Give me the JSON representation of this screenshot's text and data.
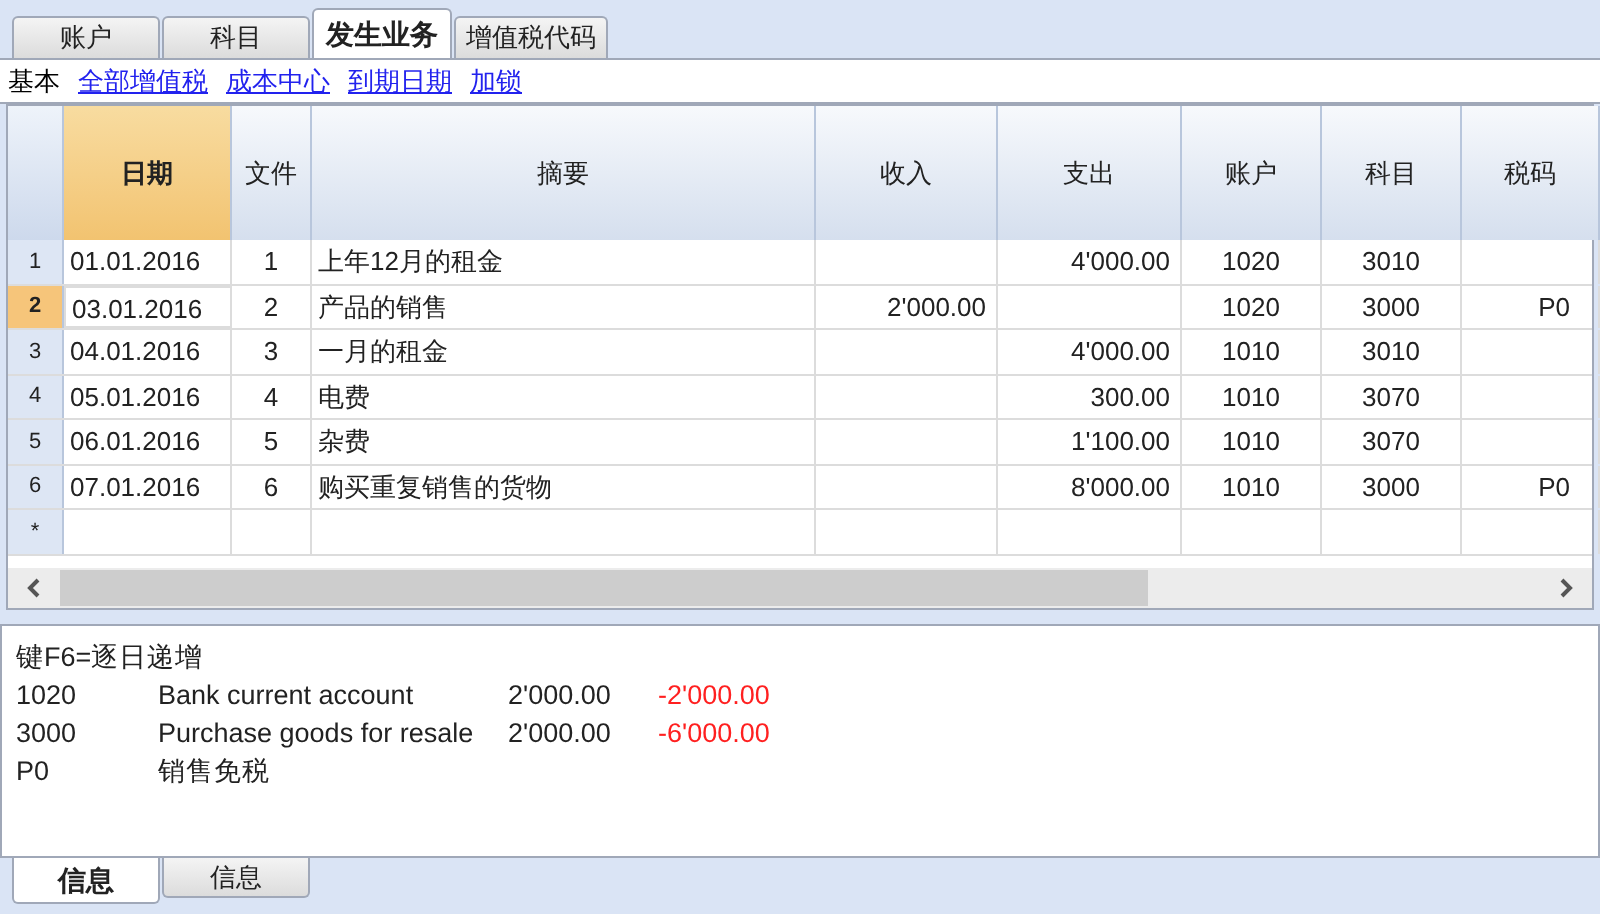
{
  "tabs": [
    {
      "label": "账户",
      "selected": false
    },
    {
      "label": "科目",
      "selected": false
    },
    {
      "label": "发生业务",
      "selected": true
    },
    {
      "label": "增值税代码",
      "selected": false
    }
  ],
  "views": [
    {
      "label": "基本",
      "selected": true
    },
    {
      "label": "全部增值税",
      "selected": false
    },
    {
      "label": "成本中心",
      "selected": false
    },
    {
      "label": "到期日期",
      "selected": false
    },
    {
      "label": "加锁",
      "selected": false
    }
  ],
  "table": {
    "columns": [
      {
        "label": "日期",
        "selected": true
      },
      {
        "label": "文件",
        "selected": false
      },
      {
        "label": "摘要",
        "selected": false
      },
      {
        "label": "收入",
        "selected": false
      },
      {
        "label": "支出",
        "selected": false
      },
      {
        "label": "账户",
        "selected": false
      },
      {
        "label": "科目",
        "selected": false
      },
      {
        "label": "税码",
        "selected": false
      }
    ],
    "rows": [
      {
        "row_header": "1",
        "selected": false,
        "cells": [
          "01.01.2016",
          "1",
          "上年12月的租金",
          "",
          "4'000.00",
          "1020",
          "3010",
          ""
        ]
      },
      {
        "row_header": "2",
        "selected": true,
        "cells": [
          "03.01.2016",
          "2",
          "产品的销售",
          "2'000.00",
          "",
          "1020",
          "3000",
          "P0"
        ]
      },
      {
        "row_header": "3",
        "selected": false,
        "cells": [
          "04.01.2016",
          "3",
          "一月的租金",
          "",
          "4'000.00",
          "1010",
          "3010",
          ""
        ]
      },
      {
        "row_header": "4",
        "selected": false,
        "cells": [
          "05.01.2016",
          "4",
          "电费",
          "",
          "300.00",
          "1010",
          "3070",
          ""
        ]
      },
      {
        "row_header": "5",
        "selected": false,
        "cells": [
          "06.01.2016",
          "5",
          "杂费",
          "",
          "1'100.00",
          "1010",
          "3070",
          ""
        ]
      },
      {
        "row_header": "6",
        "selected": false,
        "cells": [
          "07.01.2016",
          "6",
          "购买重复销售的货物",
          "",
          "8'000.00",
          "1010",
          "3000",
          "P0"
        ]
      },
      {
        "row_header": "*",
        "selected": false,
        "cells": [
          "",
          "",
          "",
          "",
          "",
          "",
          "",
          ""
        ]
      }
    ]
  },
  "info": {
    "hint": "键F6=逐日递增",
    "lines": [
      {
        "code": "1020",
        "description": "Bank current account",
        "amount": "2'000.00",
        "balance": "-2'000.00"
      },
      {
        "code": "3000",
        "description": "Purchase goods for resale",
        "amount": "2'000.00",
        "balance": "-6'000.00"
      },
      {
        "code": "P0",
        "description": "销售免税"
      }
    ]
  },
  "bottom_tabs": [
    {
      "label": "信息",
      "selected": true
    },
    {
      "label": "信息",
      "selected": false
    }
  ]
}
